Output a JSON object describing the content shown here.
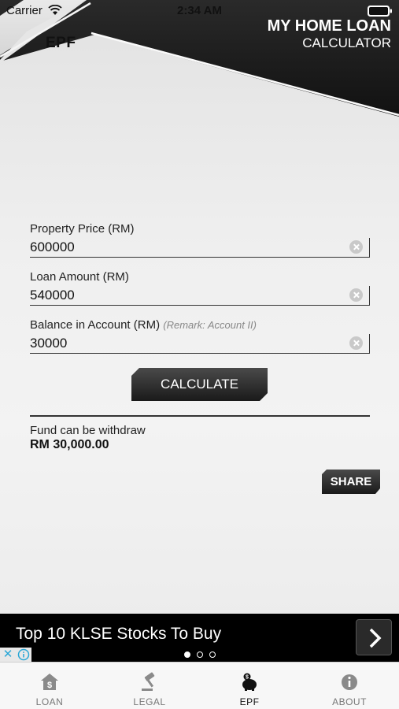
{
  "status_bar": {
    "carrier": "Carrier",
    "time": "2:34 AM"
  },
  "header": {
    "page_label": "EPF",
    "title_line1": "MY HOME LOAN",
    "title_line2": "CALCULATOR"
  },
  "form": {
    "property_price": {
      "label": "Property Price (RM)",
      "value": "600000"
    },
    "loan_amount": {
      "label": "Loan Amount (RM)",
      "value": "540000"
    },
    "balance": {
      "label": "Balance in Account (RM)",
      "remark": "(Remark: Account II)",
      "value": "30000"
    }
  },
  "calculate_label": "CALCULATE",
  "result": {
    "label": "Fund can be withdraw",
    "value": "RM 30,000.00"
  },
  "share_label": "SHARE",
  "ad": {
    "text": "Top 10 KLSE Stocks To Buy",
    "close": "✕",
    "page_count": 3,
    "active_page": 0
  },
  "tabs": [
    {
      "label": "LOAN",
      "icon": "house-dollar-icon",
      "active": false
    },
    {
      "label": "LEGAL",
      "icon": "gavel-icon",
      "active": false
    },
    {
      "label": "EPF",
      "icon": "piggy-bank-icon",
      "active": true
    },
    {
      "label": "ABOUT",
      "icon": "info-icon",
      "active": false
    }
  ],
  "colors": {
    "header_dark": "#1f1f1f",
    "button_dark": "#2b2b2b",
    "ad_background": "#000000",
    "accent_link": "#2aa7d6"
  }
}
